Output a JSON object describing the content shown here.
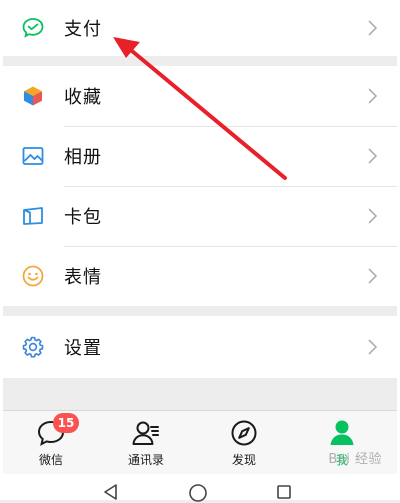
{
  "menu": {
    "pay": {
      "label": "支付",
      "icon": "wechat-pay-icon"
    },
    "favorites": {
      "label": "收藏",
      "icon": "favorites-cube-icon"
    },
    "album": {
      "label": "相册",
      "icon": "album-picture-icon"
    },
    "cards": {
      "label": "卡包",
      "icon": "card-wallet-icon"
    },
    "stickers": {
      "label": "表情",
      "icon": "smiley-icon"
    },
    "settings": {
      "label": "设置",
      "icon": "gear-icon"
    }
  },
  "tabs": [
    {
      "label": "微信",
      "icon": "chat-bubble-icon",
      "badge": "15",
      "active": false
    },
    {
      "label": "通讯录",
      "icon": "contacts-icon",
      "active": false
    },
    {
      "label": "发现",
      "icon": "compass-icon",
      "active": false
    },
    {
      "label": "我",
      "icon": "me-person-icon",
      "active": true
    }
  ],
  "android_nav": [
    "back-triangle-icon",
    "home-circle-icon",
    "recents-square-icon"
  ],
  "watermark": "Bai 经验",
  "colors": {
    "wechat_green": "#07c160",
    "badge_red": "#fa5151",
    "annotation_red": "#e8202a",
    "favorites_orange": "#f5a623",
    "album_blue": "#2f8ee0",
    "cards_blue": "#2f8ee0",
    "stickers_orange": "#f3a83b",
    "settings_blue": "#3a84dc"
  }
}
